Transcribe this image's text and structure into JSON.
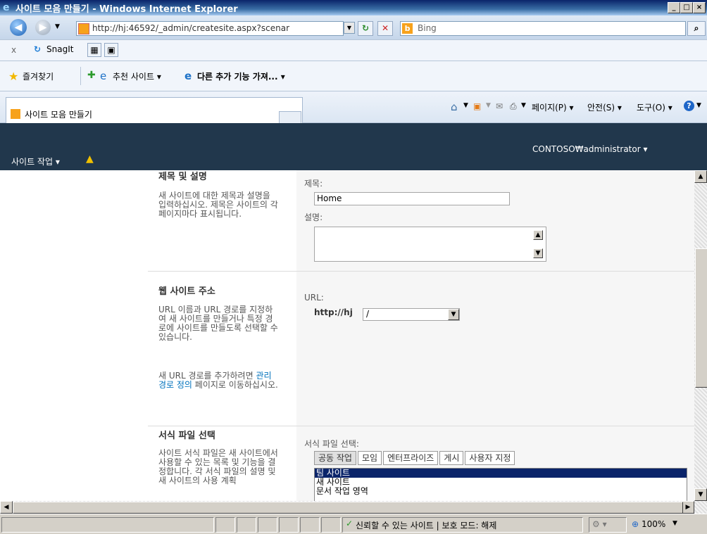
{
  "window": {
    "title": "사이트 모음 만들기 - Windows Internet Explorer",
    "btn_min": "_",
    "btn_max": "□",
    "btn_close": "×"
  },
  "address_bar": {
    "url": "http://hj:46592/_admin/createsite.aspx?scenar",
    "search_placeholder": "Bing"
  },
  "links_bar": {
    "close_label": "x",
    "snagit_label": "SnagIt"
  },
  "favorites_bar": {
    "favorites_label": "즐겨찾기",
    "suggested_sites": "추천 사이트 ▾",
    "more_addons": "다른 추가 기능 가져... ▾"
  },
  "tab_bar": {
    "tab_title": "사이트 모음 만들기",
    "page_menu": "페이지(P) ▾",
    "safety_menu": "안전(S) ▾",
    "tools_menu": "도구(O) ▾"
  },
  "ribbon": {
    "site_actions": "사이트 작업 ▾",
    "user": "CONTOSO₩administrator ▾"
  },
  "sections": {
    "title_desc": {
      "heading": "제목 및 설명",
      "description": "새 사이트에 대한 제목과 설명을 입력하십시오. 제목은 사이트의 각 페이지마다 표시됩니다.",
      "title_label": "제목:",
      "title_value": "Home",
      "desc_label": "설명:"
    },
    "web_address": {
      "heading": "웹 사이트 주소",
      "description": "URL 이름과 URL 경로를 지정하여 새 사이트를 만들거나 특정 경로에 사이트를 만들도록 선택할 수 있습니다.",
      "note_prefix": "새 URL 경로를 추가하려면 ",
      "note_link": "관리 경로 정의",
      "note_suffix": " 페이지로 이동하십시오.",
      "url_label": "URL:",
      "url_prefix": "http://hj",
      "url_path": "/"
    },
    "template": {
      "heading": "서식 파일 선택",
      "description": "사이트 서식 파일은 새 사이트에서 사용할 수 있는 목록 및 기능을 결정합니다. 각 서식 파일의 설명 및 새 사이트의 사용 계획",
      "select_label": "서식 파일 선택:",
      "tabs": [
        "공동 작업",
        "모임",
        "엔터프라이즈",
        "게시",
        "사용자 지정"
      ],
      "templates": [
        "팀 사이트",
        "새 사이트",
        "문서 작업 영역"
      ]
    }
  },
  "status_bar": {
    "zone": "신뢰할 수 있는 사이트 | 보호 모드: 해제",
    "zoom": "100%"
  }
}
